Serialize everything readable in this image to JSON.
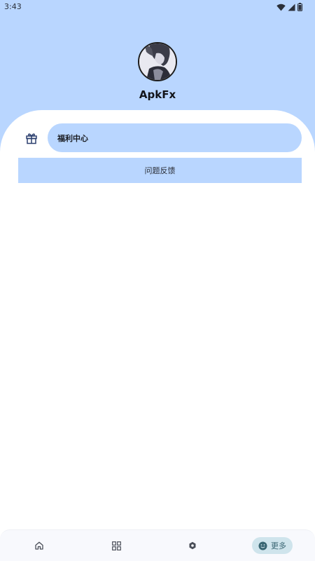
{
  "status_bar": {
    "time": "3:43",
    "icons": [
      "wifi-icon",
      "cell-signal-icon",
      "battery-icon"
    ]
  },
  "profile": {
    "name": "ApkFx",
    "avatar": "avatar-image"
  },
  "menu": {
    "welfare_center": "福利中心",
    "welfare_icon": "gift-icon",
    "feedback": "问题反馈"
  },
  "bottom_nav": {
    "items": [
      {
        "icon": "home-icon",
        "label": ""
      },
      {
        "icon": "apps-grid-icon",
        "label": ""
      },
      {
        "icon": "discover-icon",
        "label": ""
      },
      {
        "icon": "smiley-icon",
        "label": "更多",
        "selected": true
      }
    ]
  },
  "colors": {
    "header_bg": "#b9d6ff",
    "pill_bg": "#b9d6ff",
    "nav_active_bg": "#cfe4ec",
    "nav_active_fg": "#3a6673",
    "icon_blue": "#2b3f6e"
  }
}
